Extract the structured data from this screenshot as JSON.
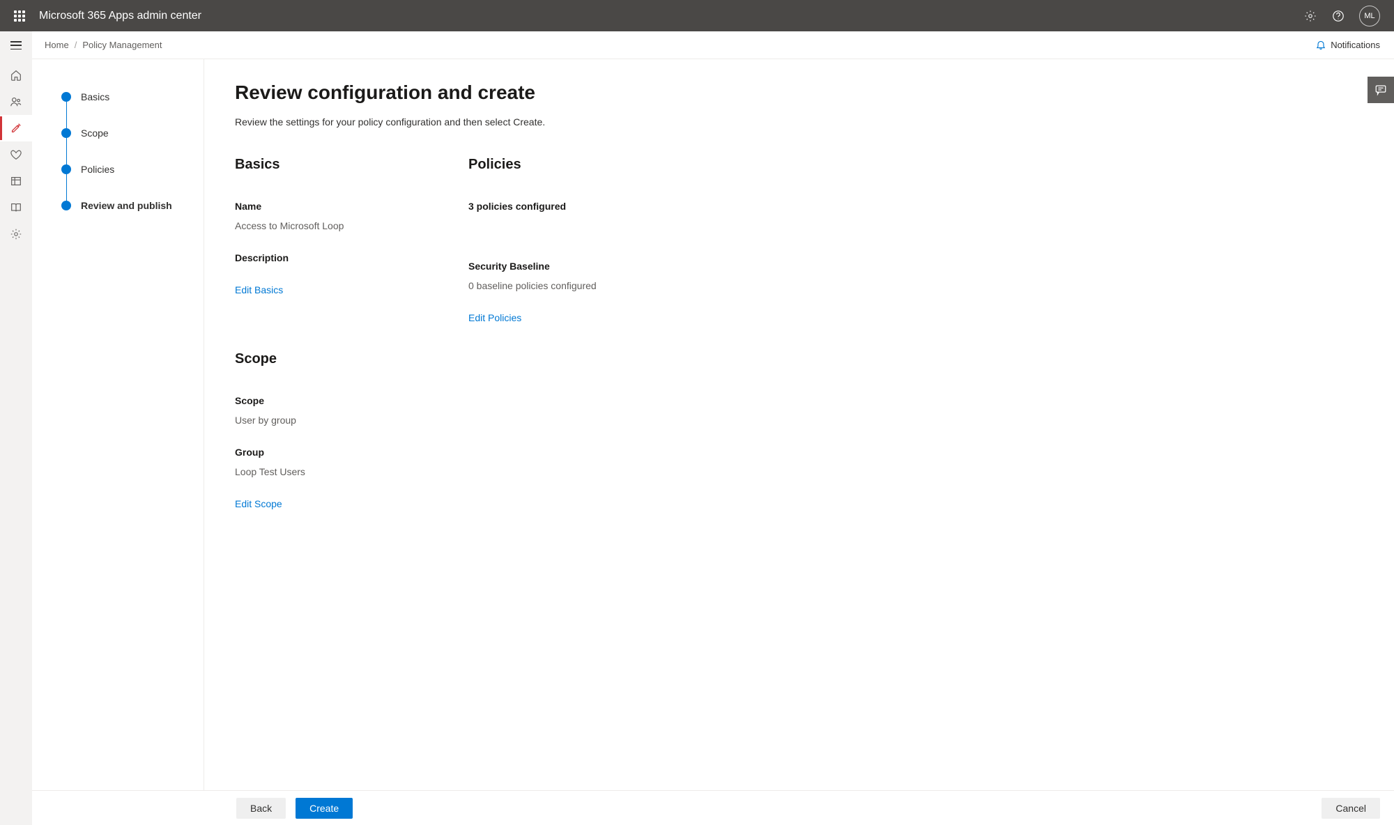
{
  "header": {
    "app_title": "Microsoft 365 Apps admin center",
    "avatar_initials": "ML"
  },
  "breadcrumb": {
    "home": "Home",
    "current": "Policy Management",
    "notifications_label": "Notifications"
  },
  "steps": {
    "items": [
      {
        "label": "Basics"
      },
      {
        "label": "Scope"
      },
      {
        "label": "Policies"
      },
      {
        "label": "Review and publish"
      }
    ]
  },
  "page": {
    "title": "Review configuration and create",
    "subtitle": "Review the settings for your policy configuration and then select Create."
  },
  "basics": {
    "heading": "Basics",
    "name_label": "Name",
    "name_value": "Access to Microsoft Loop",
    "description_label": "Description",
    "description_value": "",
    "edit_link": "Edit Basics"
  },
  "policies": {
    "heading": "Policies",
    "configured_text": "3 policies configured",
    "baseline_label": "Security Baseline",
    "baseline_value": "0 baseline policies configured",
    "edit_link": "Edit Policies"
  },
  "scope": {
    "heading": "Scope",
    "scope_label": "Scope",
    "scope_value": "User by group",
    "group_label": "Group",
    "group_value": "Loop Test Users",
    "edit_link": "Edit Scope"
  },
  "footer": {
    "back": "Back",
    "create": "Create",
    "cancel": "Cancel"
  }
}
